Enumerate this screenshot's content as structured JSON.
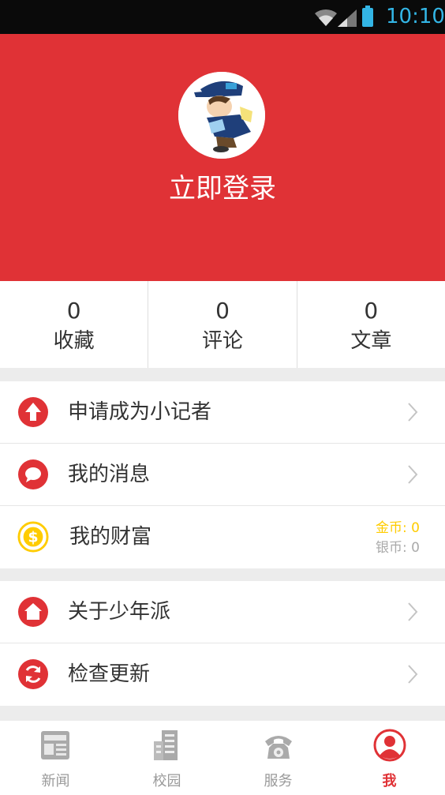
{
  "status_bar": {
    "time": "10:10"
  },
  "header": {
    "login_label": "立即登录"
  },
  "stats": [
    {
      "value": "0",
      "label": "收藏"
    },
    {
      "value": "0",
      "label": "评论"
    },
    {
      "value": "0",
      "label": "文章"
    }
  ],
  "menu": {
    "reporter": "申请成为小记者",
    "messages": "我的消息",
    "wealth": "我的财富",
    "gold_coins": "金币: 0",
    "silver_coins": "银币: 0",
    "about": "关于少年派",
    "update": "检查更新"
  },
  "nav": [
    {
      "label": "新闻",
      "icon": "newspaper-icon"
    },
    {
      "label": "校园",
      "icon": "building-icon"
    },
    {
      "label": "服务",
      "icon": "telephone-icon"
    },
    {
      "label": "我",
      "icon": "user-icon"
    }
  ],
  "colors": {
    "brand_red": "#e03236",
    "gold": "#ffcc00",
    "inactive": "#999999"
  }
}
